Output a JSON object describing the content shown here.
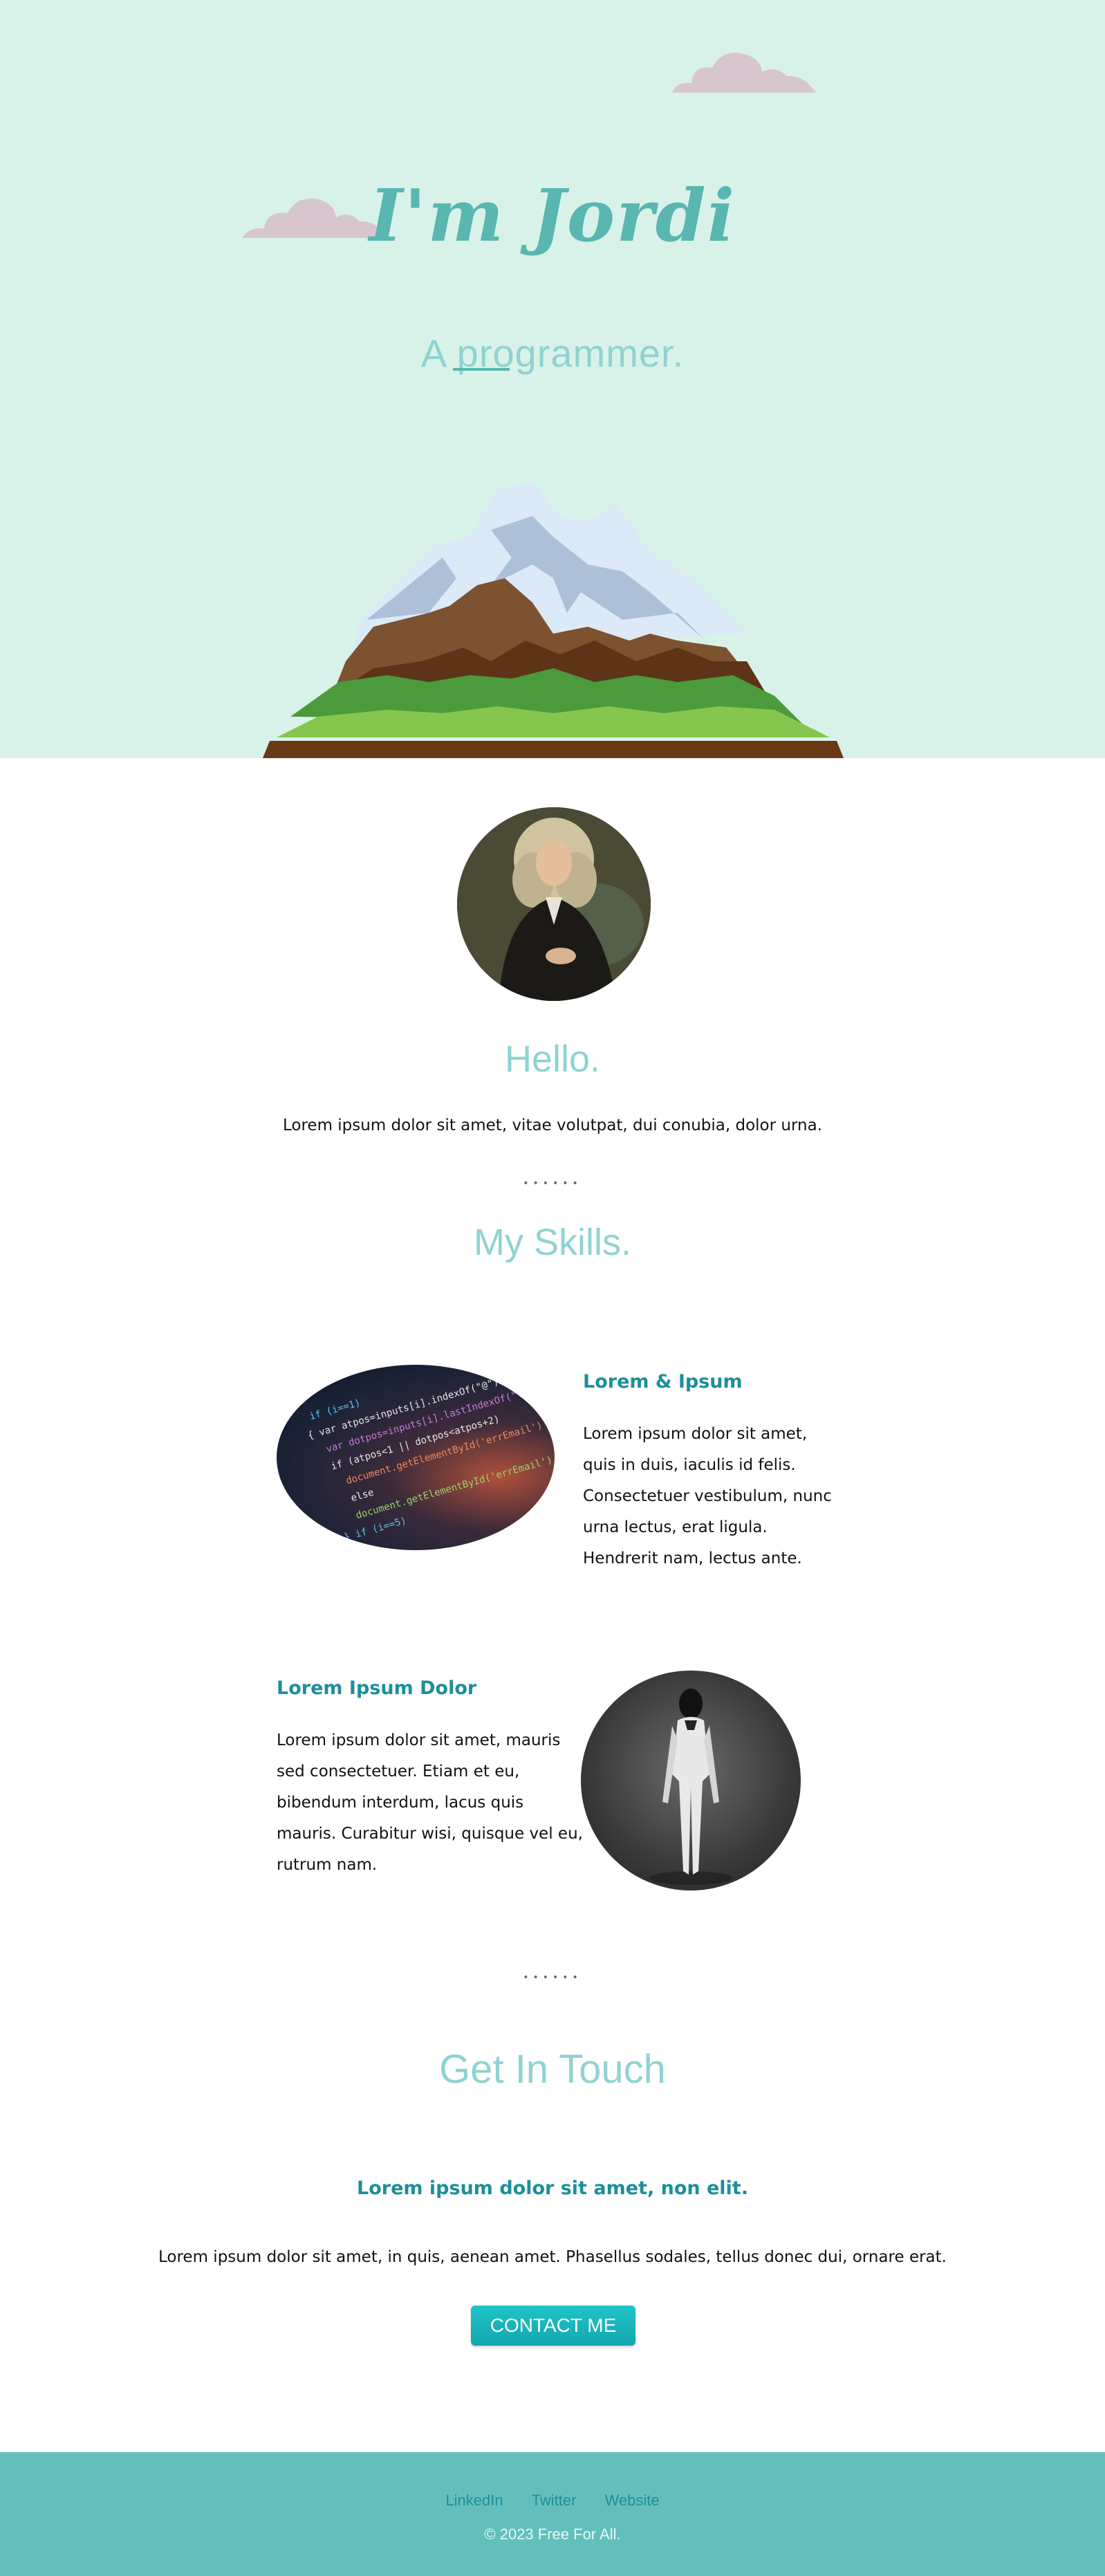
{
  "hero": {
    "title": "I'm Jordi",
    "subtitle": "A programmer."
  },
  "about": {
    "title": "Hello.",
    "text": "Lorem ipsum dolor sit amet, vitae volutpat, dui conubia, dolor urna."
  },
  "divider": "••••••",
  "skills": {
    "title": "My Skills.",
    "items": [
      {
        "title": "Lorem & Ipsum",
        "lines": [
          "Lorem ipsum dolor sit amet,",
          "quis in duis, iaculis id felis.",
          "Consectetuer vestibulum, nunc",
          "urna lectus, erat ligula.",
          "Hendrerit nam, lectus ante."
        ]
      },
      {
        "title": "Lorem Ipsum Dolor",
        "lines": [
          "Lorem ipsum dolor sit amet, mauris",
          "sed consectetuer. Etiam et eu,",
          "bibendum interdum, lacus quis",
          "mauris. Curabitur wisi, quisque vel eu,",
          "rutrum nam."
        ]
      }
    ]
  },
  "contact": {
    "title": "Get In Touch",
    "heading": "Lorem ipsum dolor sit amet, non elit.",
    "text": "Lorem ipsum dolor sit amet, in quis, aenean amet. Phasellus sodales, tellus donec dui, ornare erat.",
    "button_label": "CONTACT ME"
  },
  "footer": {
    "links": [
      "LinkedIn",
      "Twitter",
      "Website"
    ],
    "copyright": "© 2023 Free For All."
  },
  "colors": {
    "hero_bg": "#d9f2e9",
    "accent": "#59b6b1",
    "heading_light": "#8fd3d1",
    "link_teal": "#1c8f9a",
    "footer_bg": "#63bfbc"
  }
}
